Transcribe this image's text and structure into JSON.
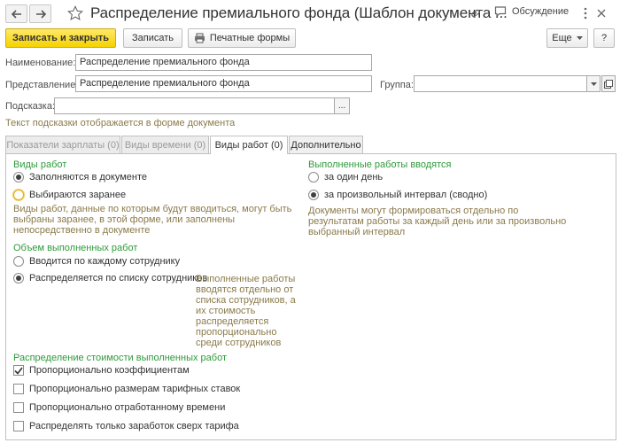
{
  "window": {
    "title": "Распределение премиального фонда (Шаблон документа ...",
    "discussion_label": "Обсуждение"
  },
  "toolbar": {
    "save_close_label": "Записать и закрыть",
    "save_label": "Записать",
    "print_label": "Печатные формы",
    "more_label": "Еще",
    "help_label": "?"
  },
  "form": {
    "name_label": "Наименование:",
    "name_value": "Распределение премиального фонда",
    "presentation_label": "Представление:",
    "presentation_value": "Распределение премиального фонда",
    "group_label": "Группа:",
    "group_value": "",
    "hint_label": "Подсказка:",
    "hint_value": "",
    "hint_button": "...",
    "hint_note": "Текст подсказки отображается в форме документа"
  },
  "tabs": [
    {
      "label": "Показатели зарплаты (0)",
      "state": "disabled"
    },
    {
      "label": "Виды времени (0)",
      "state": "disabled"
    },
    {
      "label": "Виды работ (0)",
      "state": "active"
    },
    {
      "label": "Дополнительно",
      "state": "normal"
    }
  ],
  "work_types": {
    "title": "Виды работ",
    "options": [
      {
        "label": "Заполняются в документе",
        "selected": true
      },
      {
        "label": "Выбираются заранее",
        "selected": false
      }
    ],
    "description": "Виды работ, данные по которым будут вводиться, могут быть выбраны заранее, в этой форме, или заполнены непосредственно в документе"
  },
  "completed_work": {
    "title": "Выполненные работы вводятся",
    "options": [
      {
        "label": "за один день",
        "selected": false
      },
      {
        "label": "за произвольный интервал (сводно)",
        "selected": true
      }
    ],
    "description": "Документы могут формироваться отдельно по результатам работы за каждый день или за произвольно выбранный интервал"
  },
  "volume": {
    "title": "Объем выполненных работ",
    "options": [
      {
        "label": "Вводится по каждому сотруднику",
        "selected": false
      },
      {
        "label": "Распределяется по списку сотрудников",
        "selected": true
      }
    ],
    "description": "Выполненные работы вводятся отдельно от списка сотрудников, а их стоимость распределяется пропорционально среди сотрудников"
  },
  "cost_distribution": {
    "title": "Распределение стоимости выполненных работ",
    "options": [
      {
        "label": "Пропорционально коэффициентам",
        "checked": true
      },
      {
        "label": "Пропорционально размерам тарифных ставок",
        "checked": false
      },
      {
        "label": "Пропорционально отработанному времени",
        "checked": false
      },
      {
        "label": "Распределять только заработок сверх тарифа",
        "checked": false
      }
    ]
  },
  "colors": {
    "accent_yellow": "#f5d200",
    "group_title_green": "#2e9a3a",
    "hint_text": "#8a7a4a"
  }
}
